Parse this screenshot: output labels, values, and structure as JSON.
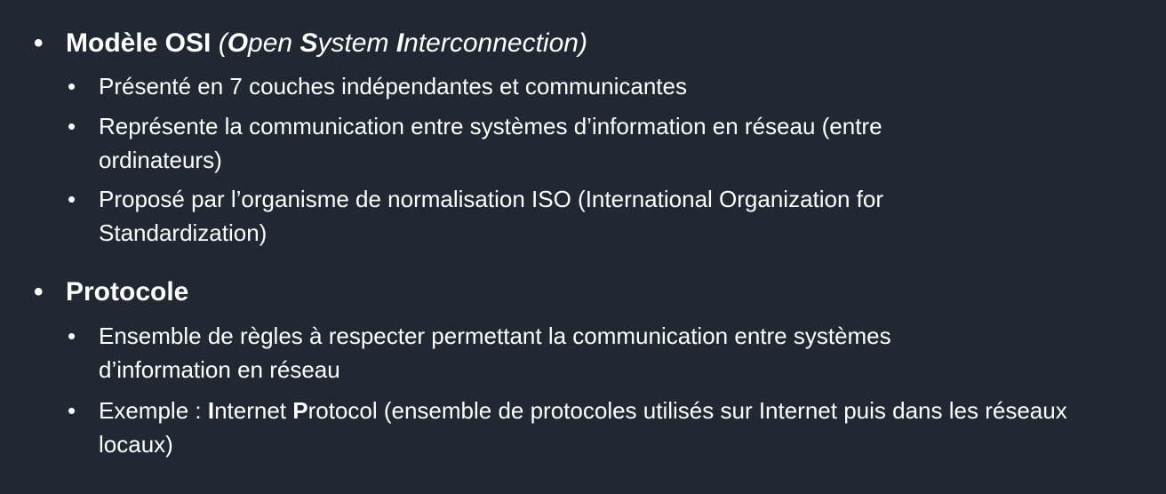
{
  "bullet_char": "•",
  "items": [
    {
      "title_bold": "Modèle OSI",
      "title_paren_open": "(",
      "title_o": "O",
      "title_pen": "pen ",
      "title_s": "S",
      "title_ystem": "ystem ",
      "title_i": "I",
      "title_nterconnection": "nterconnection)",
      "subitems": [
        {
          "text": "Présenté en 7 couches indépendantes et communicantes"
        },
        {
          "text": "Représente la communication entre systèmes d’information en réseau (entre ordinateurs)"
        },
        {
          "text": "Proposé par l’organisme de normalisation ISO (International Organization for Standardization)"
        }
      ]
    },
    {
      "title_bold": "Protocole",
      "subitems": [
        {
          "text": "Ensemble de règles à respecter permettant la communication entre systèmes d’information en réseau"
        },
        {
          "prefix": "Exemple : ",
          "bold_i": "I",
          "nternet": "nternet ",
          "bold_p": "P",
          "rest": "rotocol (ensemble de protocoles utilisés sur Internet puis dans les réseaux locaux)"
        }
      ]
    }
  ]
}
